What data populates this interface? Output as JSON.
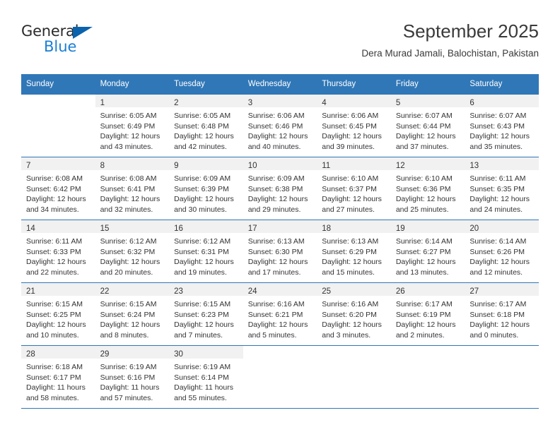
{
  "brand": {
    "name_part1": "General",
    "name_part2": "Blue",
    "triangle_color": "#0b63ad",
    "blue_color": "#1b7fd4"
  },
  "header": {
    "title": "September 2025",
    "subtitle": "Dera Murad Jamali, Balochistan, Pakistan"
  },
  "theme": {
    "header_bg": "#3077b7",
    "daynum_bg": "#f1f1f1",
    "grid_line": "#2f76b6",
    "text": "#333333"
  },
  "calendar": {
    "weekday_headers": [
      "Sunday",
      "Monday",
      "Tuesday",
      "Wednesday",
      "Thursday",
      "Friday",
      "Saturday"
    ],
    "weeks": [
      [
        {
          "day": "",
          "sunrise": "",
          "sunset": "",
          "daylight1": "",
          "daylight2": ""
        },
        {
          "day": "1",
          "sunrise": "Sunrise: 6:05 AM",
          "sunset": "Sunset: 6:49 PM",
          "daylight1": "Daylight: 12 hours",
          "daylight2": "and 43 minutes."
        },
        {
          "day": "2",
          "sunrise": "Sunrise: 6:05 AM",
          "sunset": "Sunset: 6:48 PM",
          "daylight1": "Daylight: 12 hours",
          "daylight2": "and 42 minutes."
        },
        {
          "day": "3",
          "sunrise": "Sunrise: 6:06 AM",
          "sunset": "Sunset: 6:46 PM",
          "daylight1": "Daylight: 12 hours",
          "daylight2": "and 40 minutes."
        },
        {
          "day": "4",
          "sunrise": "Sunrise: 6:06 AM",
          "sunset": "Sunset: 6:45 PM",
          "daylight1": "Daylight: 12 hours",
          "daylight2": "and 39 minutes."
        },
        {
          "day": "5",
          "sunrise": "Sunrise: 6:07 AM",
          "sunset": "Sunset: 6:44 PM",
          "daylight1": "Daylight: 12 hours",
          "daylight2": "and 37 minutes."
        },
        {
          "day": "6",
          "sunrise": "Sunrise: 6:07 AM",
          "sunset": "Sunset: 6:43 PM",
          "daylight1": "Daylight: 12 hours",
          "daylight2": "and 35 minutes."
        }
      ],
      [
        {
          "day": "7",
          "sunrise": "Sunrise: 6:08 AM",
          "sunset": "Sunset: 6:42 PM",
          "daylight1": "Daylight: 12 hours",
          "daylight2": "and 34 minutes."
        },
        {
          "day": "8",
          "sunrise": "Sunrise: 6:08 AM",
          "sunset": "Sunset: 6:41 PM",
          "daylight1": "Daylight: 12 hours",
          "daylight2": "and 32 minutes."
        },
        {
          "day": "9",
          "sunrise": "Sunrise: 6:09 AM",
          "sunset": "Sunset: 6:39 PM",
          "daylight1": "Daylight: 12 hours",
          "daylight2": "and 30 minutes."
        },
        {
          "day": "10",
          "sunrise": "Sunrise: 6:09 AM",
          "sunset": "Sunset: 6:38 PM",
          "daylight1": "Daylight: 12 hours",
          "daylight2": "and 29 minutes."
        },
        {
          "day": "11",
          "sunrise": "Sunrise: 6:10 AM",
          "sunset": "Sunset: 6:37 PM",
          "daylight1": "Daylight: 12 hours",
          "daylight2": "and 27 minutes."
        },
        {
          "day": "12",
          "sunrise": "Sunrise: 6:10 AM",
          "sunset": "Sunset: 6:36 PM",
          "daylight1": "Daylight: 12 hours",
          "daylight2": "and 25 minutes."
        },
        {
          "day": "13",
          "sunrise": "Sunrise: 6:11 AM",
          "sunset": "Sunset: 6:35 PM",
          "daylight1": "Daylight: 12 hours",
          "daylight2": "and 24 minutes."
        }
      ],
      [
        {
          "day": "14",
          "sunrise": "Sunrise: 6:11 AM",
          "sunset": "Sunset: 6:33 PM",
          "daylight1": "Daylight: 12 hours",
          "daylight2": "and 22 minutes."
        },
        {
          "day": "15",
          "sunrise": "Sunrise: 6:12 AM",
          "sunset": "Sunset: 6:32 PM",
          "daylight1": "Daylight: 12 hours",
          "daylight2": "and 20 minutes."
        },
        {
          "day": "16",
          "sunrise": "Sunrise: 6:12 AM",
          "sunset": "Sunset: 6:31 PM",
          "daylight1": "Daylight: 12 hours",
          "daylight2": "and 19 minutes."
        },
        {
          "day": "17",
          "sunrise": "Sunrise: 6:13 AM",
          "sunset": "Sunset: 6:30 PM",
          "daylight1": "Daylight: 12 hours",
          "daylight2": "and 17 minutes."
        },
        {
          "day": "18",
          "sunrise": "Sunrise: 6:13 AM",
          "sunset": "Sunset: 6:29 PM",
          "daylight1": "Daylight: 12 hours",
          "daylight2": "and 15 minutes."
        },
        {
          "day": "19",
          "sunrise": "Sunrise: 6:14 AM",
          "sunset": "Sunset: 6:27 PM",
          "daylight1": "Daylight: 12 hours",
          "daylight2": "and 13 minutes."
        },
        {
          "day": "20",
          "sunrise": "Sunrise: 6:14 AM",
          "sunset": "Sunset: 6:26 PM",
          "daylight1": "Daylight: 12 hours",
          "daylight2": "and 12 minutes."
        }
      ],
      [
        {
          "day": "21",
          "sunrise": "Sunrise: 6:15 AM",
          "sunset": "Sunset: 6:25 PM",
          "daylight1": "Daylight: 12 hours",
          "daylight2": "and 10 minutes."
        },
        {
          "day": "22",
          "sunrise": "Sunrise: 6:15 AM",
          "sunset": "Sunset: 6:24 PM",
          "daylight1": "Daylight: 12 hours",
          "daylight2": "and 8 minutes."
        },
        {
          "day": "23",
          "sunrise": "Sunrise: 6:15 AM",
          "sunset": "Sunset: 6:23 PM",
          "daylight1": "Daylight: 12 hours",
          "daylight2": "and 7 minutes."
        },
        {
          "day": "24",
          "sunrise": "Sunrise: 6:16 AM",
          "sunset": "Sunset: 6:21 PM",
          "daylight1": "Daylight: 12 hours",
          "daylight2": "and 5 minutes."
        },
        {
          "day": "25",
          "sunrise": "Sunrise: 6:16 AM",
          "sunset": "Sunset: 6:20 PM",
          "daylight1": "Daylight: 12 hours",
          "daylight2": "and 3 minutes."
        },
        {
          "day": "26",
          "sunrise": "Sunrise: 6:17 AM",
          "sunset": "Sunset: 6:19 PM",
          "daylight1": "Daylight: 12 hours",
          "daylight2": "and 2 minutes."
        },
        {
          "day": "27",
          "sunrise": "Sunrise: 6:17 AM",
          "sunset": "Sunset: 6:18 PM",
          "daylight1": "Daylight: 12 hours",
          "daylight2": "and 0 minutes."
        }
      ],
      [
        {
          "day": "28",
          "sunrise": "Sunrise: 6:18 AM",
          "sunset": "Sunset: 6:17 PM",
          "daylight1": "Daylight: 11 hours",
          "daylight2": "and 58 minutes."
        },
        {
          "day": "29",
          "sunrise": "Sunrise: 6:19 AM",
          "sunset": "Sunset: 6:16 PM",
          "daylight1": "Daylight: 11 hours",
          "daylight2": "and 57 minutes."
        },
        {
          "day": "30",
          "sunrise": "Sunrise: 6:19 AM",
          "sunset": "Sunset: 6:14 PM",
          "daylight1": "Daylight: 11 hours",
          "daylight2": "and 55 minutes."
        },
        {
          "day": "",
          "sunrise": "",
          "sunset": "",
          "daylight1": "",
          "daylight2": ""
        },
        {
          "day": "",
          "sunrise": "",
          "sunset": "",
          "daylight1": "",
          "daylight2": ""
        },
        {
          "day": "",
          "sunrise": "",
          "sunset": "",
          "daylight1": "",
          "daylight2": ""
        },
        {
          "day": "",
          "sunrise": "",
          "sunset": "",
          "daylight1": "",
          "daylight2": ""
        }
      ]
    ]
  }
}
